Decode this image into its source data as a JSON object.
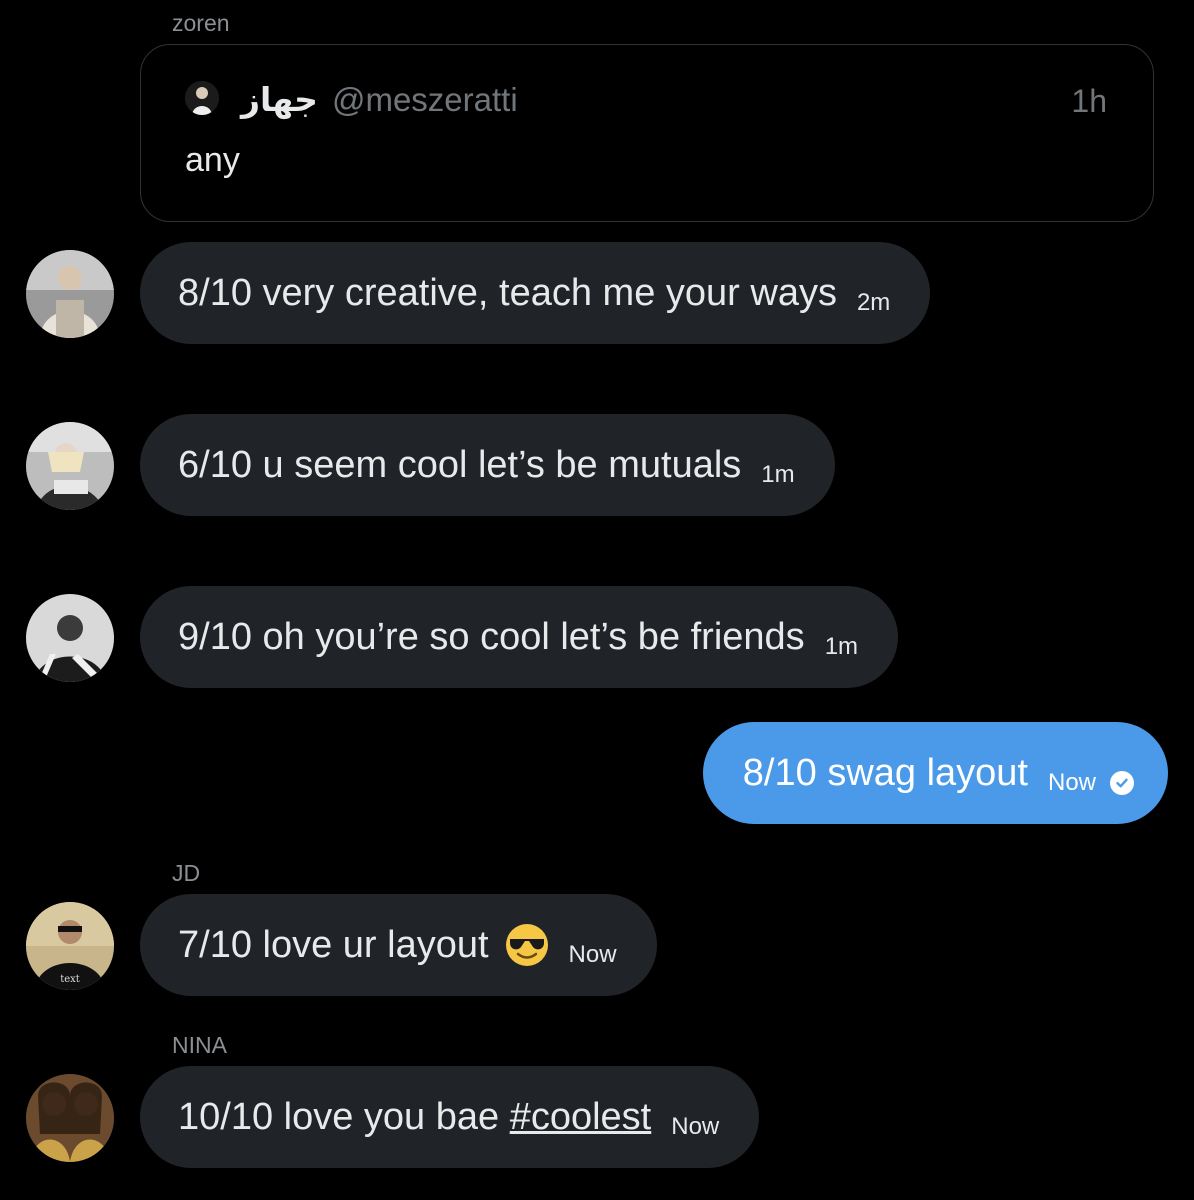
{
  "quote_block": {
    "sender": "zoren",
    "display_name": "جهاز",
    "handle": "@meszeratti",
    "time": "1h",
    "text": "any"
  },
  "messages": [
    {
      "text": "8/10 very creative, teach me your ways",
      "time": "2m"
    },
    {
      "text": "6/10 u seem cool let’s be mutuals",
      "time": "1m"
    },
    {
      "text": "9/10 oh you’re so cool let’s be friends",
      "time": "1m"
    },
    {
      "text": "8/10 swag layout",
      "time": "Now",
      "sent": true
    },
    {
      "sender": "JD",
      "text": "7/10 love ur layout",
      "emoji": "sunglasses-emoji",
      "time": "Now"
    },
    {
      "sender": "NINA",
      "text_prefix": "10/10 love you bae ",
      "hashtag": "#coolest",
      "time": "Now"
    }
  ],
  "colors": {
    "background": "#000000",
    "bubble_received": "#202327",
    "bubble_sent": "#4a9ae9",
    "muted_text": "#71767b"
  }
}
